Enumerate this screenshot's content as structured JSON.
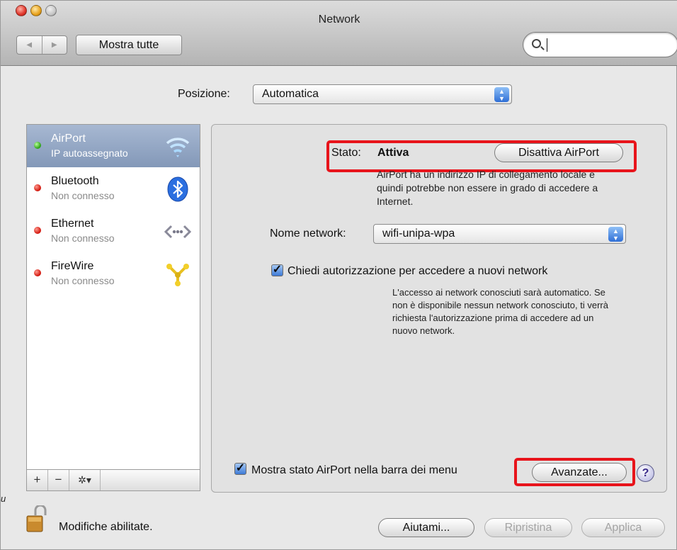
{
  "window": {
    "title": "Network"
  },
  "toolbar": {
    "back_glyph": "◀",
    "forward_glyph": "▶",
    "show_all_label": "Mostra tutte",
    "search_value": ""
  },
  "location": {
    "label": "Posizione:",
    "value": "Automatica"
  },
  "services": [
    {
      "name": "AirPort",
      "status": "IP autoassegnato",
      "indicator": "green",
      "icon": "wifi-icon",
      "selected": true
    },
    {
      "name": "Bluetooth",
      "status": "Non connesso",
      "indicator": "red",
      "icon": "bluetooth-icon",
      "selected": false
    },
    {
      "name": "Ethernet",
      "status": "Non connesso",
      "indicator": "red",
      "icon": "ethernet-icon",
      "selected": false
    },
    {
      "name": "FireWire",
      "status": "Non connesso",
      "indicator": "red",
      "icon": "firewire-icon",
      "selected": false
    }
  ],
  "sidebar_tools": {
    "add": "+",
    "remove": "−",
    "gear": "✲▾"
  },
  "status": {
    "label": "Stato:",
    "value": "Attiva",
    "toggle_button": "Disattiva AirPort",
    "info": "AirPort ha un indirizzo IP di collegamento locale e quindi potrebbe non essere in grado di accedere a Internet."
  },
  "network_name": {
    "label": "Nome network:",
    "value": "wifi-unipa-wpa"
  },
  "ask_to_join": {
    "checked": true,
    "label": "Chiedi autorizzazione per accedere a nuovi network",
    "info": "L'accesso ai network conosciuti sarà automatico. Se non è disponibile nessun network conosciuto, ti verrà richiesta l'autorizzazione prima di accedere ad un nuovo network."
  },
  "menu_bar_status": {
    "checked": true,
    "label": "Mostra stato AirPort nella barra dei menu"
  },
  "buttons": {
    "advanced": "Avanzate...",
    "help": "?",
    "assist": "Aiutami...",
    "revert": "Ripristina",
    "apply": "Applica"
  },
  "lock": {
    "text": "Modifiche abilitate."
  },
  "stray_text": "u",
  "colors": {
    "highlight": "#e8141b",
    "selection": "#8fa3c2",
    "status_green": "#2fa318",
    "status_red": "#d31a10"
  }
}
